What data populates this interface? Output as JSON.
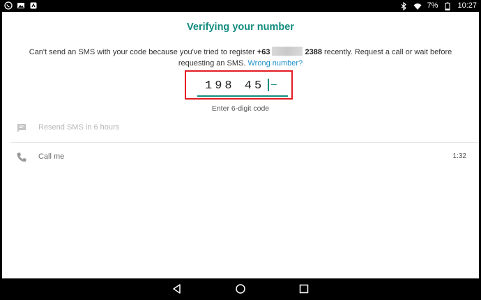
{
  "status_bar": {
    "icons_left": [
      "whatsapp-icon",
      "image-icon",
      "app-icon"
    ],
    "icons_right": [
      "bluetooth-icon",
      "wifi-icon"
    ],
    "battery": "7%",
    "time": "10:27"
  },
  "verify": {
    "title": "Verifying your number",
    "message_before": "Can't send an SMS with your code because you've tried to register ",
    "country_code": "+63",
    "number_tail": "2388",
    "message_after": " recently. Request a call or wait before requesting an SMS.",
    "wrong_number_link": "Wrong number?",
    "code_entered": "198 45",
    "code_remaining": "–",
    "code_hint": "Enter 6-digit code"
  },
  "options": {
    "resend_sms": "Resend SMS in 6 hours",
    "call_me": "Call me",
    "call_timer": "1:32"
  },
  "colors": {
    "accent": "#128c7e",
    "link": "#1b8fc6",
    "highlight_border": "#e21b22"
  }
}
